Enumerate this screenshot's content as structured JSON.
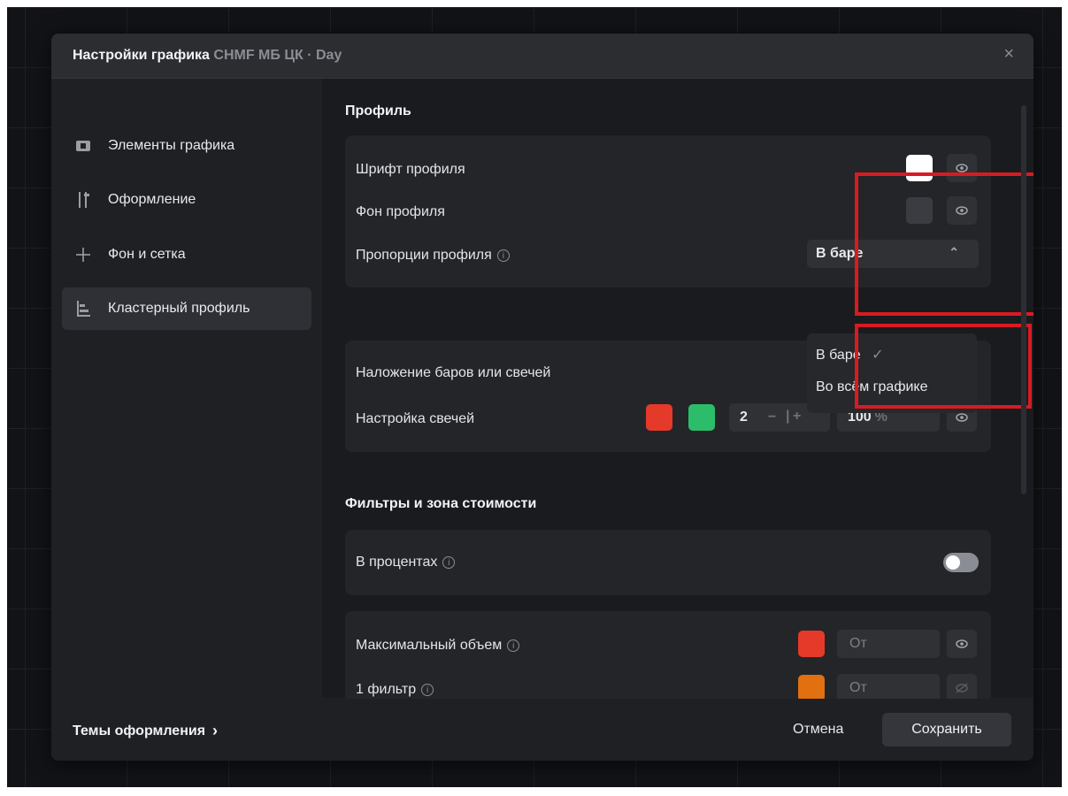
{
  "dialog": {
    "title": "Настройки графика",
    "subtitle": "CHMF МБ ЦК · Day"
  },
  "sidebar": {
    "items": [
      {
        "label": "Элементы графика",
        "icon": "chart-elements-icon"
      },
      {
        "label": "Оформление",
        "icon": "style-sliders-icon"
      },
      {
        "label": "Фон и сетка",
        "icon": "plus-grid-icon"
      },
      {
        "label": "Кластерный профиль",
        "icon": "cluster-profile-icon",
        "active": true
      }
    ]
  },
  "profile": {
    "section_title": "Профиль",
    "font_label": "Шрифт профиля",
    "font_color": "#ffffff",
    "bg_label": "Фон профиля",
    "bg_color": "#3a3c41",
    "proportions_label": "Пропорции профиля",
    "proportions_value": "В баре",
    "dropdown_options": [
      "В баре",
      "Во всём графике"
    ],
    "dropdown_selected": "В баре"
  },
  "overlay": {
    "label": "Наложение баров или свечей",
    "candles_label": "Настройка свечей",
    "down_color": "#e5392a",
    "up_color": "#2bbd6a",
    "width_value": "2",
    "opacity_value": "100",
    "opacity_unit": "%"
  },
  "filters": {
    "section_title": "Фильтры и зона стоимости",
    "percent_label": "В процентах",
    "percent_enabled": false,
    "rows": [
      {
        "label": "Максимальный объем",
        "color": "#e5392a",
        "from": "От",
        "visible": true
      },
      {
        "label": "1 фильтр",
        "color": "#e07010",
        "from": "От",
        "visible": false
      }
    ]
  },
  "footer": {
    "themes_label": "Темы оформления",
    "cancel_label": "Отмена",
    "save_label": "Сохранить"
  }
}
